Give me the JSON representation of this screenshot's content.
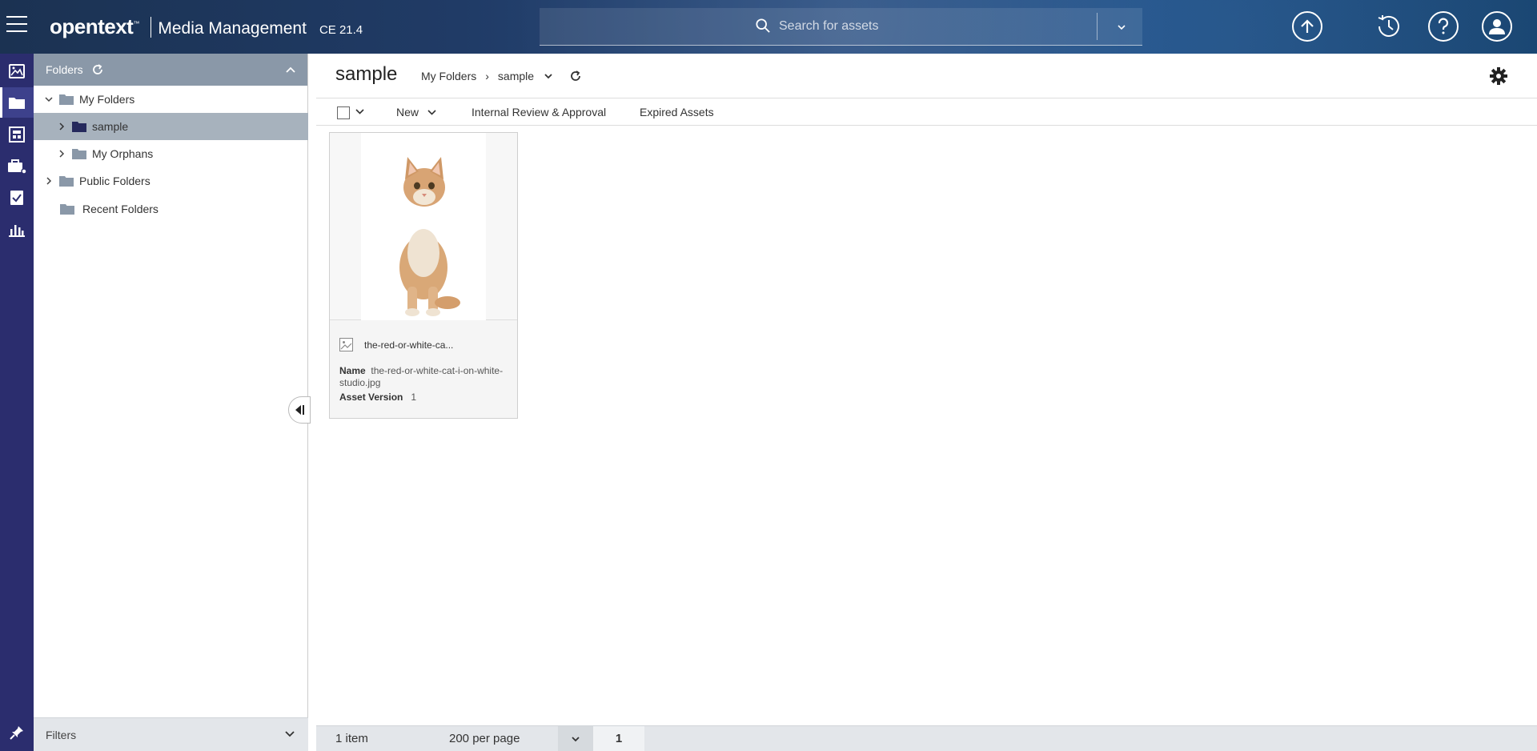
{
  "header": {
    "brand_logo": "opentext",
    "brand_tm": "™",
    "product": "Media Management",
    "version": "CE 21.4",
    "search_placeholder": "Search for assets"
  },
  "rail": {
    "items": [
      "images-icon",
      "folders-icon",
      "collections-icon",
      "briefcase-icon",
      "tasks-icon",
      "reports-icon"
    ],
    "active": "folders-icon"
  },
  "folders_panel": {
    "title": "Folders",
    "tree": [
      {
        "label": "My Folders",
        "level": 0,
        "expanded": true
      },
      {
        "label": "sample",
        "level": 1,
        "expanded": false,
        "selected": true
      },
      {
        "label": "My Orphans",
        "level": 1,
        "expanded": false
      },
      {
        "label": "Public Folders",
        "level": 0,
        "expanded": false
      },
      {
        "label": "Recent Folders",
        "level": 0,
        "expanded": null
      }
    ],
    "filters_label": "Filters"
  },
  "main": {
    "title": "sample",
    "breadcrumb": [
      "My Folders",
      "sample"
    ],
    "breadcrumb_sep": "›",
    "toolbar": {
      "new_label": "New",
      "review_label": "Internal Review & Approval",
      "expired_label": "Expired Assets"
    },
    "assets": [
      {
        "short_name": "the-red-or-white-ca...",
        "name_label": "Name",
        "name": "the-red-or-white-cat-i-on-white-studio.jpg",
        "version_label": "Asset Version",
        "version": "1"
      }
    ],
    "footer": {
      "count": "1 item",
      "per_page": "200 per page",
      "page": "1"
    }
  },
  "colors": {
    "rail": "#2b2d6e",
    "panel_header": "#8a98a8",
    "selected_row": "#a7b2bd",
    "footer": "#e3e6ea"
  }
}
